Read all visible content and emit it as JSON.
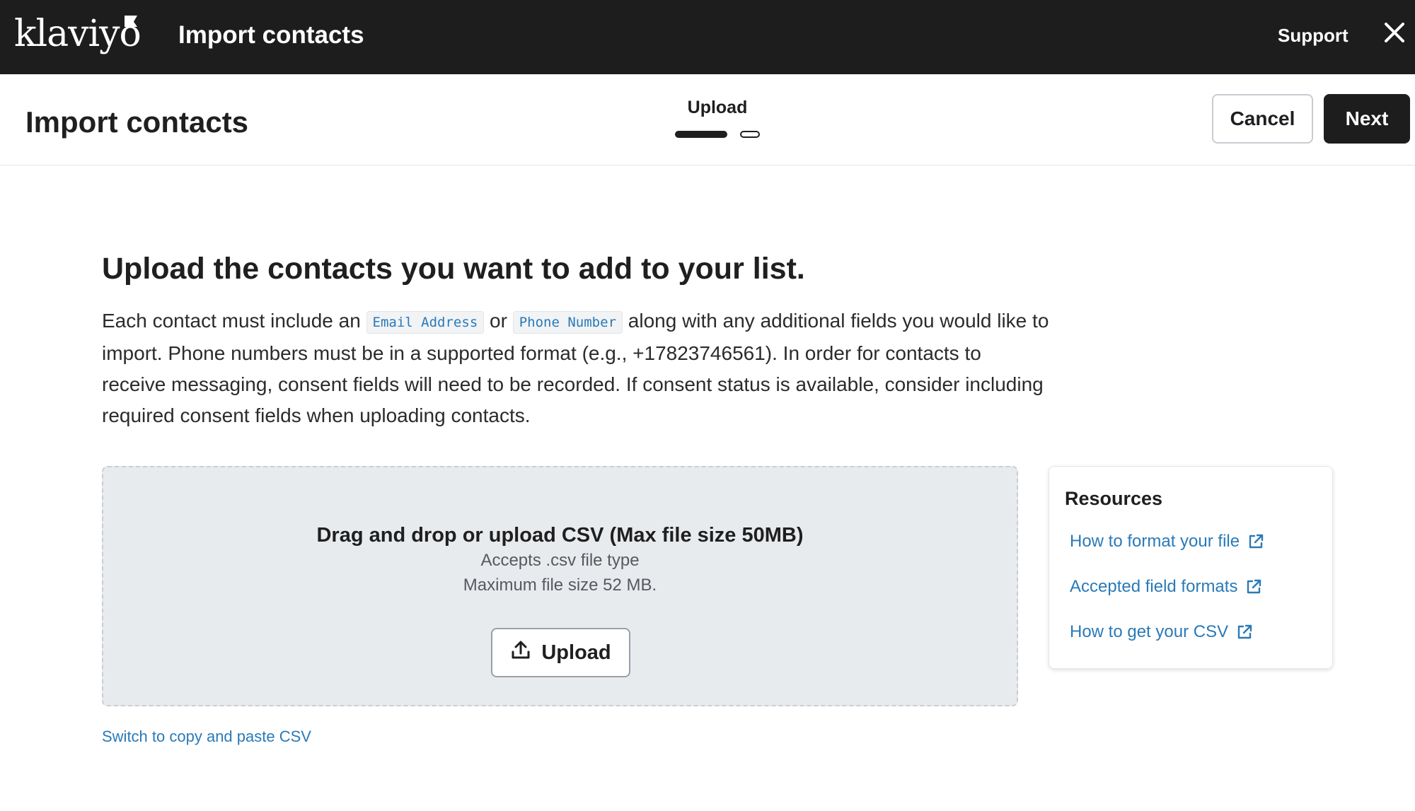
{
  "topbar": {
    "logo_text": "klaviyo",
    "title": "Import contacts",
    "support_label": "Support",
    "close_icon": "close-icon"
  },
  "header": {
    "page_title": "Import contacts",
    "step_label": "Upload",
    "steps_total": 2,
    "current_step": 1,
    "cancel_label": "Cancel",
    "next_label": "Next"
  },
  "main": {
    "heading": "Upload the contacts you want to add to your list.",
    "desc_part1": "Each contact must include an ",
    "email_chip": "Email Address",
    "desc_or": " or ",
    "phone_chip": "Phone Number",
    "desc_part2": " along with any additional fields you would like to import. Phone numbers must be in a supported format (e.g., +17823746561). In order for contacts to receive messaging, consent fields will need to be recorded. If consent status is available, consider including required consent fields when uploading contacts.",
    "dropzone": {
      "title": "Drag and drop or upload CSV (Max file size 50MB)",
      "accepts": "Accepts .csv file type",
      "max_size": "Maximum file size 52 MB.",
      "upload_label": "Upload",
      "upload_icon": "upload-icon"
    },
    "switch_link": "Switch to copy and paste CSV"
  },
  "resources": {
    "title": "Resources",
    "links": [
      {
        "label": "How to format your file",
        "icon": "external-link-icon"
      },
      {
        "label": "Accepted field formats",
        "icon": "external-link-icon"
      },
      {
        "label": "How to get your CSV",
        "icon": "external-link-icon"
      }
    ]
  },
  "colors": {
    "topbar_bg": "#1d1d1d",
    "link": "#2a7ab8",
    "dropzone_bg": "#e8ebee"
  }
}
